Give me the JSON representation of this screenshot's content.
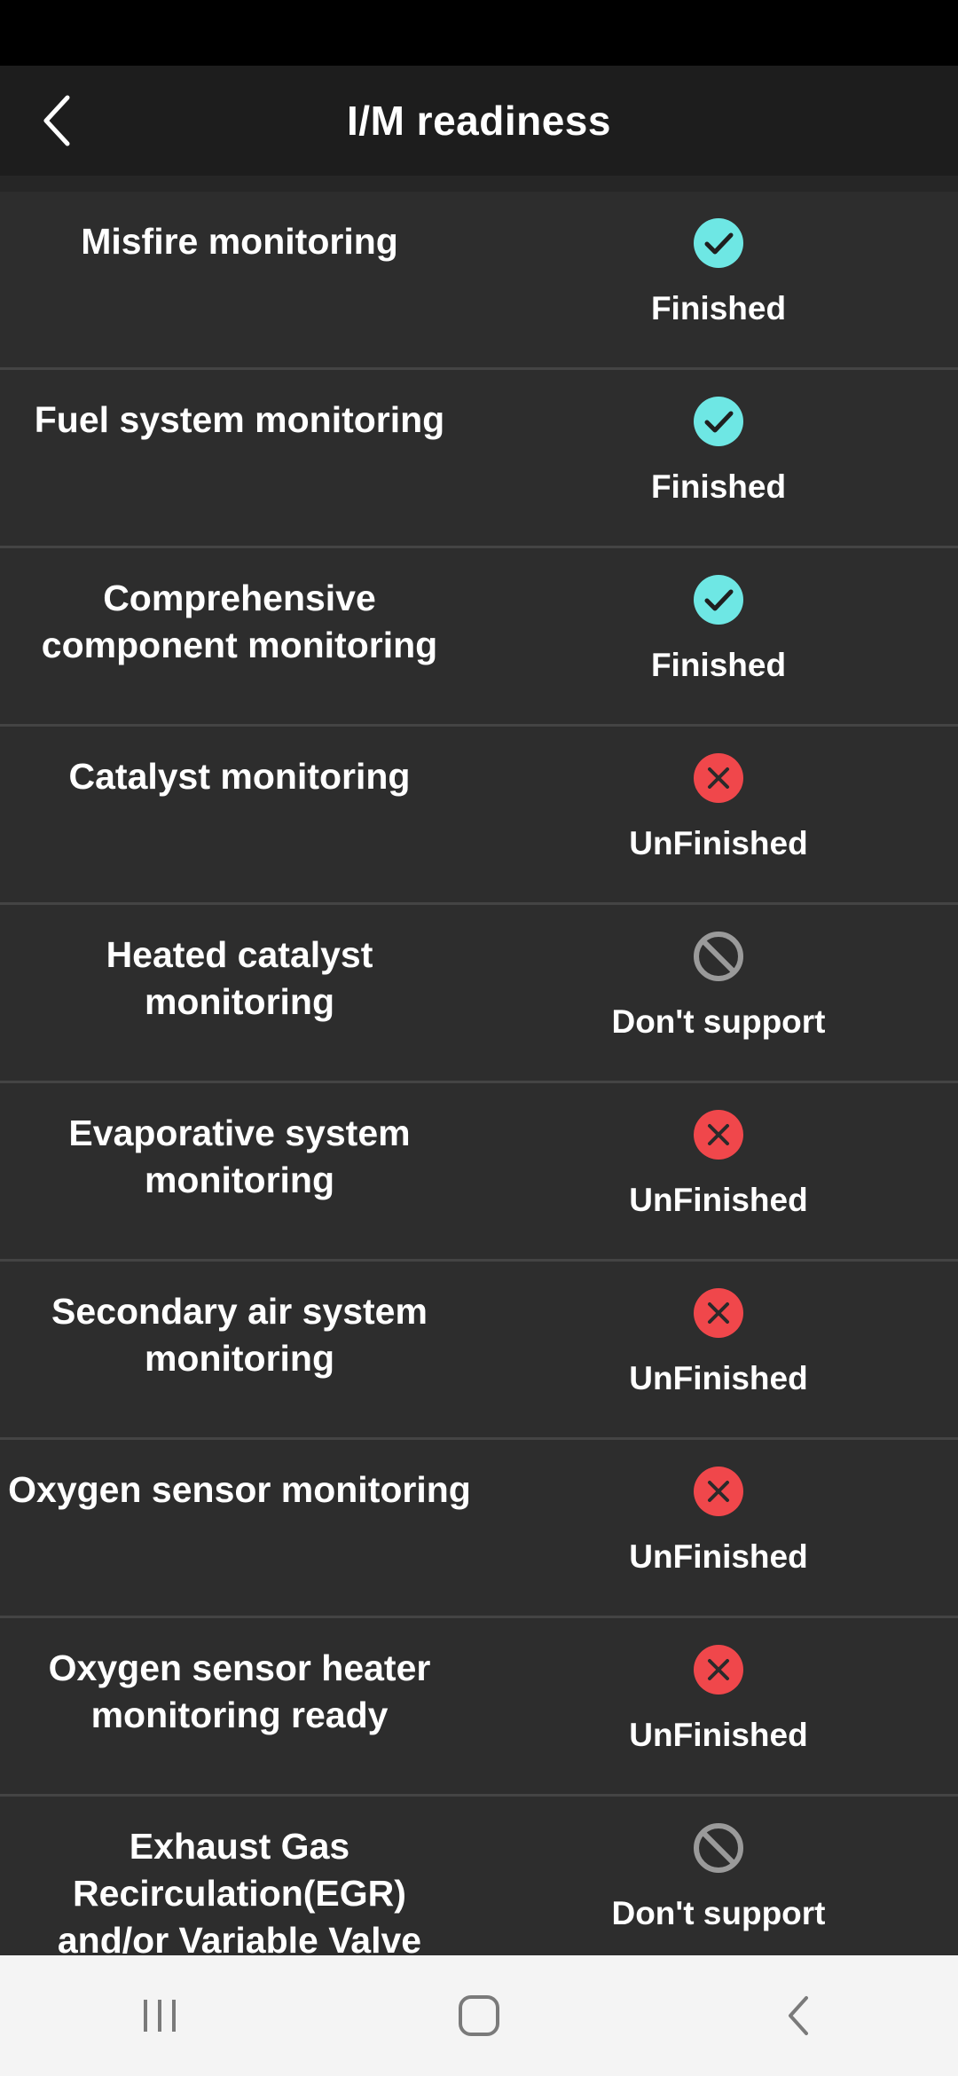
{
  "header": {
    "title": "I/M readiness",
    "back_icon": "chevron-left-icon"
  },
  "colors": {
    "finished": "#6ee7e4",
    "unfinished": "#f0474b",
    "unsupported": "#9a9a9a",
    "background": "#2d2d2d",
    "app_bar": "#1d1d1d"
  },
  "items": [
    {
      "name": "Misfire monitoring",
      "status": "Finished",
      "icon": "check-circle-icon"
    },
    {
      "name": "Fuel system monitoring",
      "status": "Finished",
      "icon": "check-circle-icon"
    },
    {
      "name": "Comprehensive component monitoring",
      "status": "Finished",
      "icon": "check-circle-icon"
    },
    {
      "name": "Catalyst monitoring",
      "status": "UnFinished",
      "icon": "x-circle-icon"
    },
    {
      "name": "Heated catalyst monitoring",
      "status": "Don't support",
      "icon": "prohibited-icon"
    },
    {
      "name": "Evaporative system monitoring",
      "status": "UnFinished",
      "icon": "x-circle-icon"
    },
    {
      "name": "Secondary air system monitoring",
      "status": "UnFinished",
      "icon": "x-circle-icon"
    },
    {
      "name": "Oxygen sensor monitoring",
      "status": "UnFinished",
      "icon": "x-circle-icon"
    },
    {
      "name": "Oxygen sensor heater monitoring ready",
      "status": "UnFinished",
      "icon": "x-circle-icon"
    },
    {
      "name": "Exhaust Gas Recirculation(EGR) and/or Variable Valve",
      "status": "Don't support",
      "icon": "prohibited-icon"
    }
  ],
  "navigation": {
    "recents_icon": "recents-icon",
    "home_icon": "home-icon",
    "back_icon": "back-icon"
  }
}
